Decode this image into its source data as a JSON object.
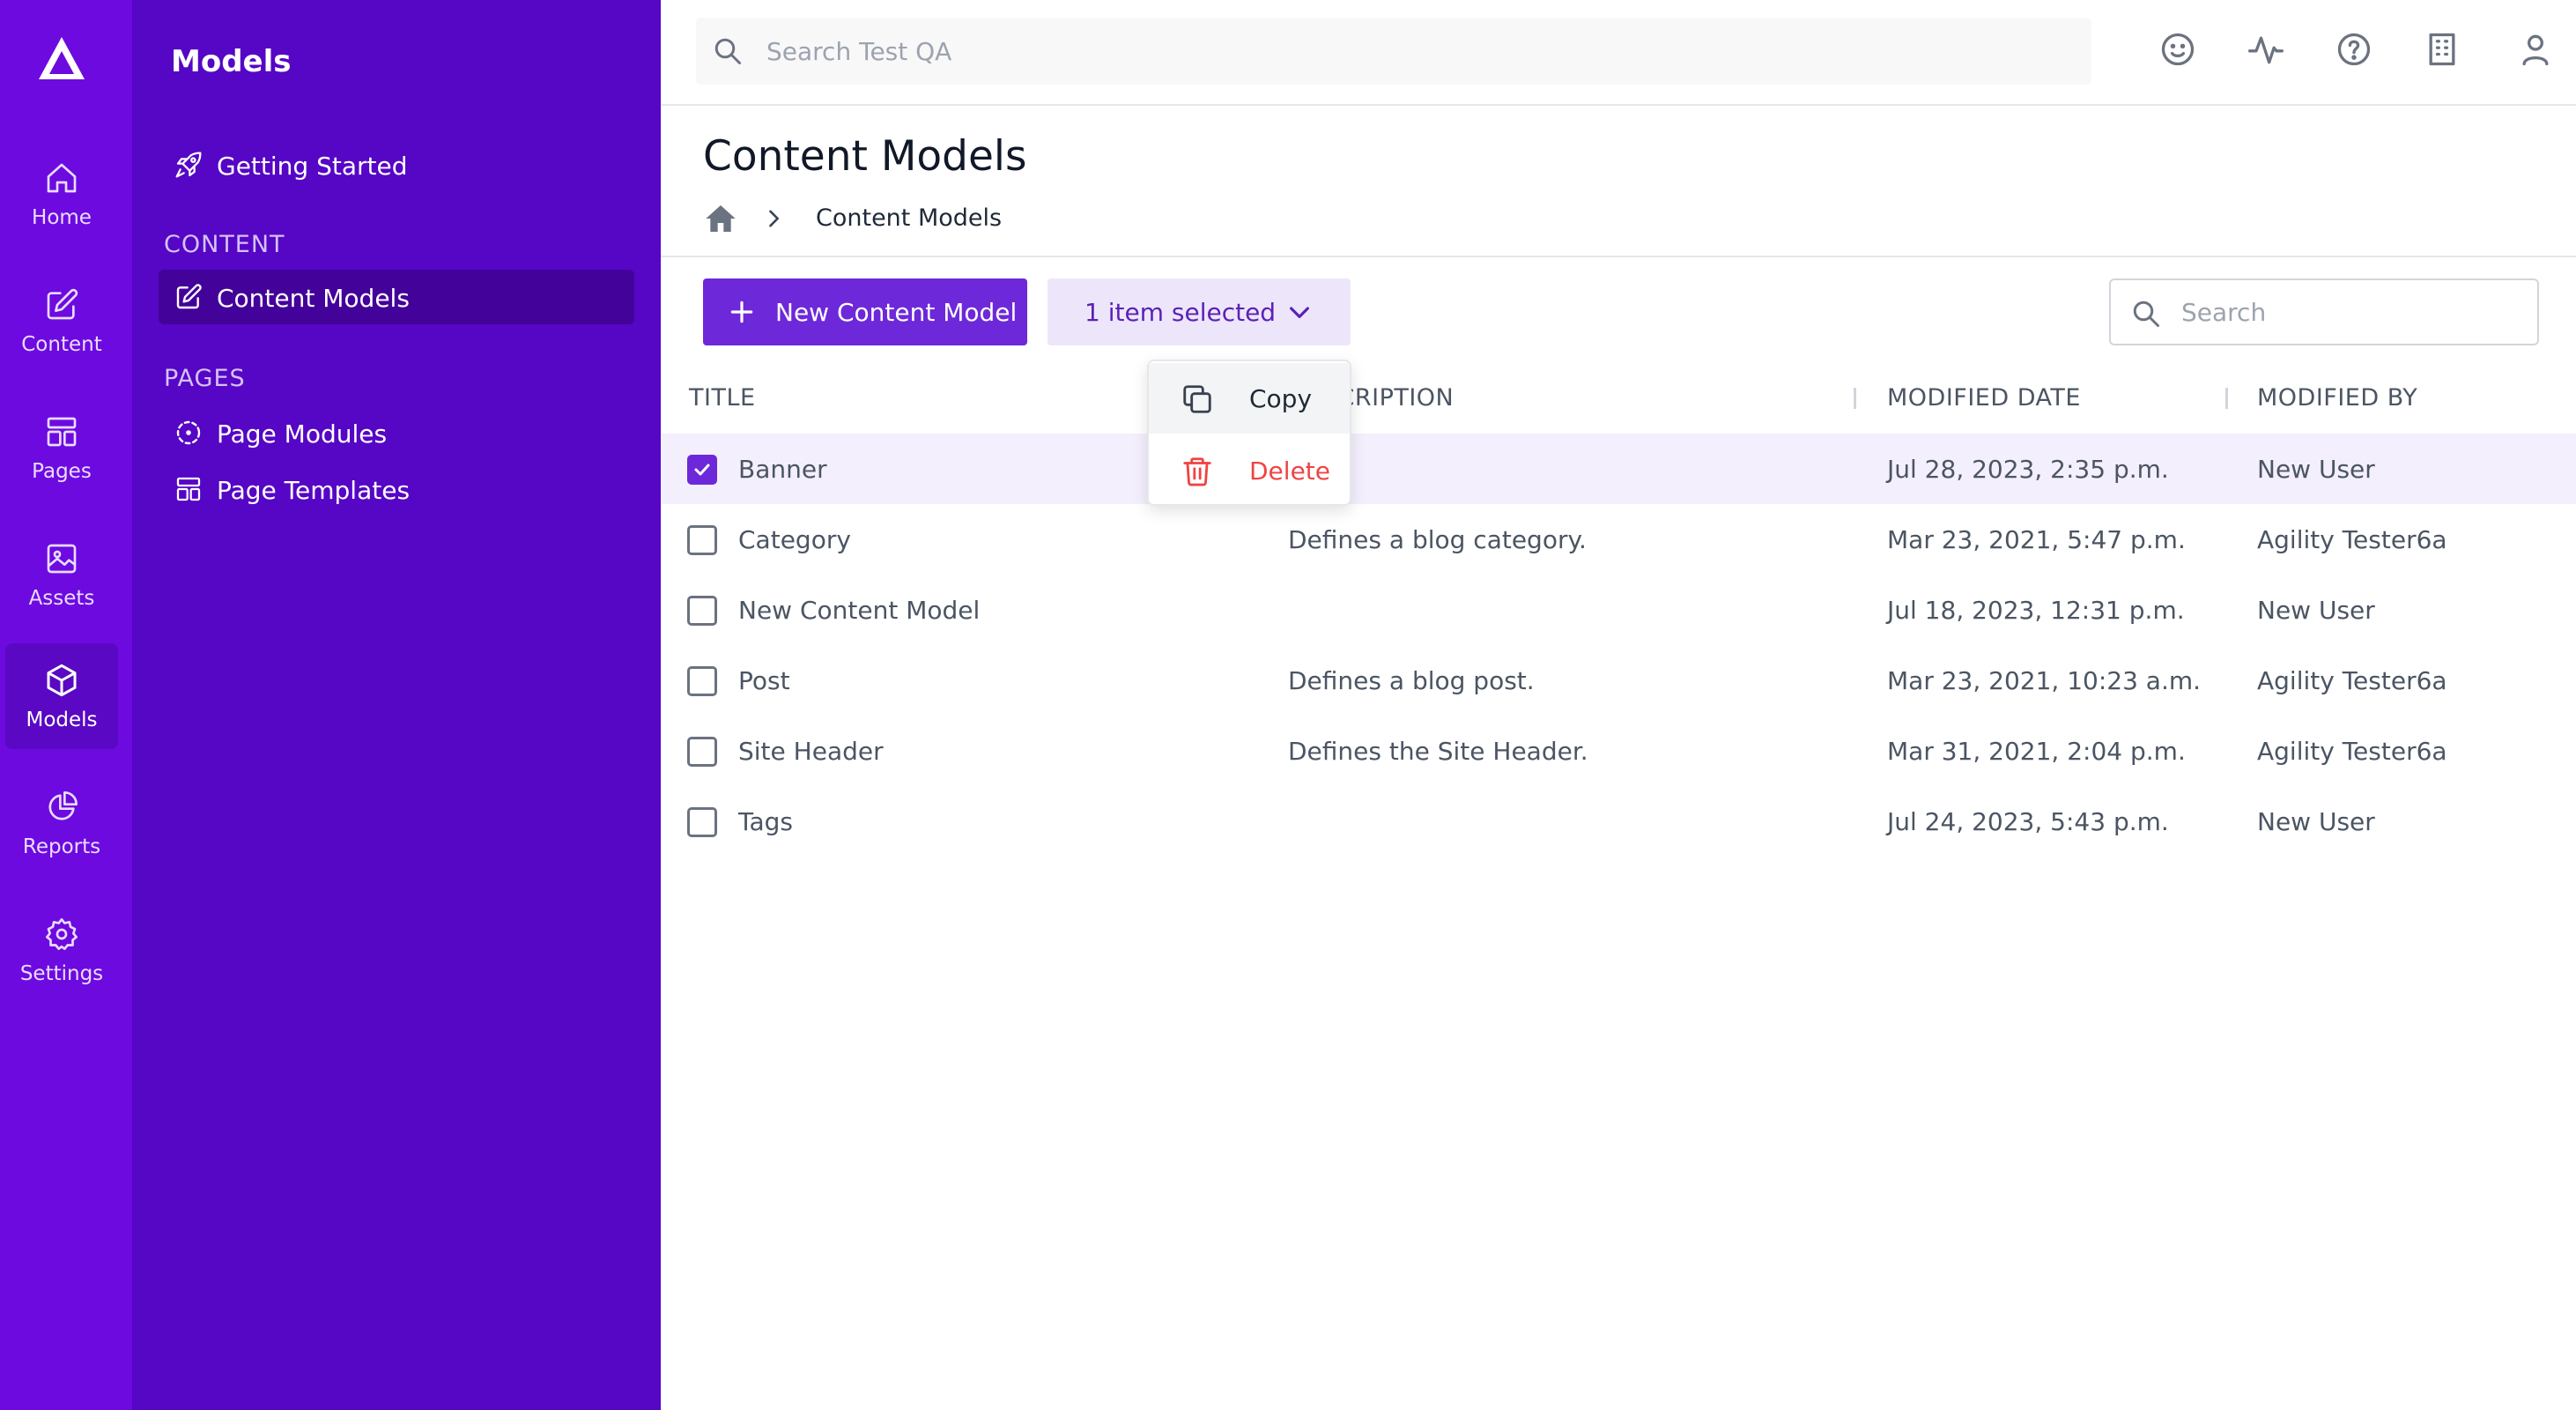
{
  "rail": {
    "items": [
      {
        "label": "Home",
        "icon": "home-icon"
      },
      {
        "label": "Content",
        "icon": "pencil-square-icon"
      },
      {
        "label": "Pages",
        "icon": "layout-icon"
      },
      {
        "label": "Assets",
        "icon": "image-icon"
      },
      {
        "label": "Models",
        "icon": "cube-icon",
        "active": true
      },
      {
        "label": "Reports",
        "icon": "pie-chart-icon"
      },
      {
        "label": "Settings",
        "icon": "gear-icon"
      }
    ]
  },
  "subnav": {
    "title": "Models",
    "getting_started": "Getting Started",
    "content_section": "CONTENT",
    "content_models": "Content Models",
    "pages_section": "PAGES",
    "page_modules": "Page Modules",
    "page_templates": "Page Templates"
  },
  "topbar": {
    "search_placeholder": "Search Test QA",
    "icons": [
      "smiley-icon",
      "activity-icon",
      "help-icon",
      "building-icon",
      "user-icon"
    ]
  },
  "page": {
    "title": "Content Models",
    "breadcrumb_current": "Content Models"
  },
  "toolbar": {
    "new_label": "New Content Model",
    "selected_label": "1 item selected",
    "search_placeholder": "Search"
  },
  "menu": {
    "copy": "Copy",
    "delete": "Delete"
  },
  "table": {
    "headers": {
      "title": "TITLE",
      "description": "DESCRIPTION",
      "modified_date": "MODIFIED DATE",
      "modified_by": "MODIFIED BY"
    },
    "rows": [
      {
        "title": "Banner",
        "description": "",
        "modified_date": "Jul 28, 2023, 2:35 p.m.",
        "modified_by": "New User",
        "checked": true
      },
      {
        "title": "Category",
        "description": "Defines a blog category.",
        "modified_date": "Mar 23, 2021, 5:47 p.m.",
        "modified_by": "Agility Tester6a",
        "checked": false
      },
      {
        "title": "New Content Model",
        "description": "",
        "modified_date": "Jul 18, 2023, 12:31 p.m.",
        "modified_by": "New User",
        "checked": false
      },
      {
        "title": "Post",
        "description": "Defines a blog post.",
        "modified_date": "Mar 23, 2021, 10:23 a.m.",
        "modified_by": "Agility Tester6a",
        "checked": false
      },
      {
        "title": "Site Header",
        "description": "Defines the Site Header.",
        "modified_date": "Mar 31, 2021, 2:04 p.m.",
        "modified_by": "Agility Tester6a",
        "checked": false
      },
      {
        "title": "Tags",
        "description": "",
        "modified_date": "Jul 24, 2023, 5:43 p.m.",
        "modified_by": "New User",
        "checked": false
      }
    ]
  },
  "colors": {
    "rail": "#6d0ae0",
    "subnav": "#5606c5",
    "accent": "#6d28d9",
    "danger": "#ef4444"
  }
}
